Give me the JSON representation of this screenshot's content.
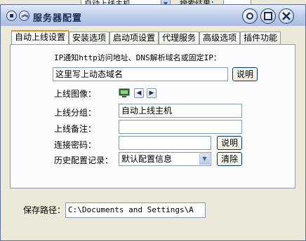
{
  "background": {
    "combo_value": "自动上线主机",
    "search_label": "搜索结果："
  },
  "window": {
    "title": "服务器配置",
    "buttons": {
      "minimize": "○",
      "maximize": "□",
      "close": "✕"
    }
  },
  "tabs": [
    {
      "label": "自动上线设置",
      "active": true
    },
    {
      "label": "安装选项",
      "active": false
    },
    {
      "label": "启动项设置",
      "active": false
    },
    {
      "label": "代理服务",
      "active": false
    },
    {
      "label": "高级选项",
      "active": false
    },
    {
      "label": "插件功能",
      "active": false
    }
  ],
  "form": {
    "ip_prompt": "IP通知http访问地址、DNS解析域名或固定IP：",
    "ip_value": "这里写上动态域名",
    "ip_help_button": "说明",
    "image_label": "上线图像：",
    "group_label": "上线分组：",
    "group_value": "自动上线主机",
    "note_label": "上线备注：",
    "note_value": "",
    "password_label": "连接密码：",
    "password_value": "",
    "password_help_button": "说明",
    "history_label": "历史配置记录：",
    "history_value": "默认配置信息",
    "clear_button": "清除",
    "save_path_label": "保存路径：",
    "save_path_value": "C:\\Documents and Settings\\A"
  },
  "icons": {
    "image_icon": "computer-icon",
    "prev": "◀",
    "next": "▶"
  }
}
